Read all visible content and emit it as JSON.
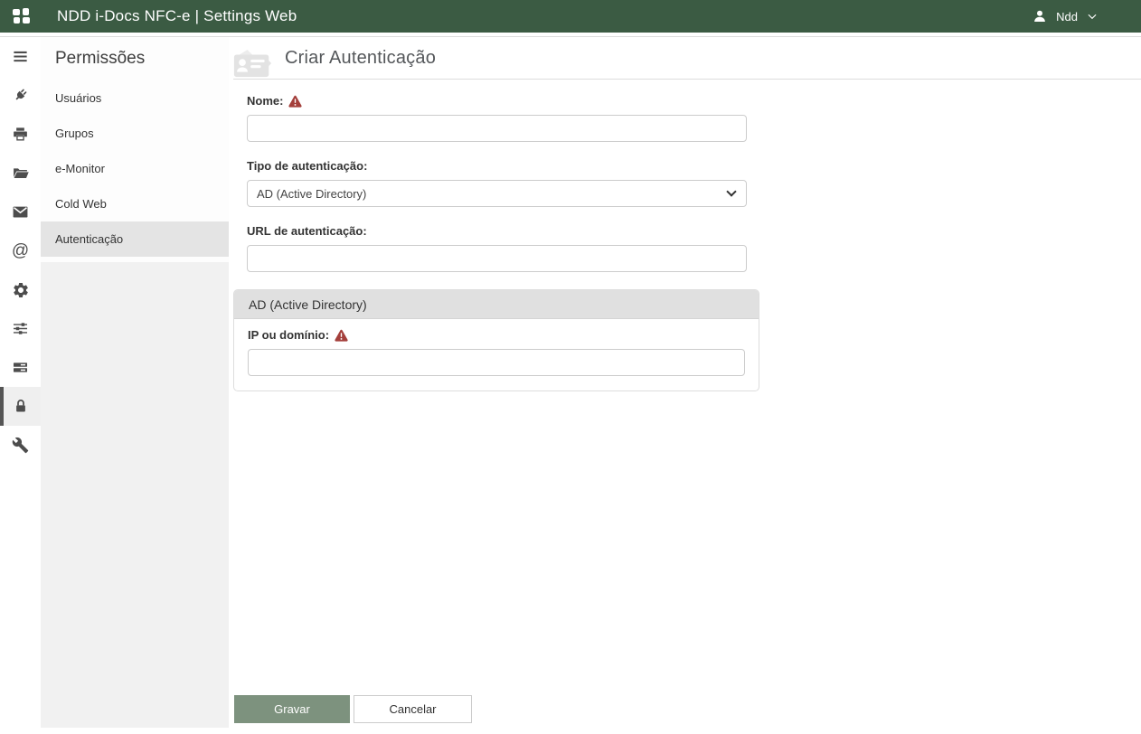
{
  "topbar": {
    "title": "NDD i-Docs NFC-e | Settings Web",
    "user": "Ndd"
  },
  "rail": {
    "items": [
      {
        "icon": "menu-icon",
        "selected": false
      },
      {
        "icon": "plug-icon",
        "selected": false
      },
      {
        "icon": "printer-icon",
        "selected": false
      },
      {
        "icon": "folder-open-icon",
        "selected": false
      },
      {
        "icon": "envelope-icon",
        "selected": false
      },
      {
        "icon": "at-icon",
        "selected": false
      },
      {
        "icon": "gear-icon",
        "selected": false
      },
      {
        "icon": "sliders-icon",
        "selected": false
      },
      {
        "icon": "stack-icon",
        "selected": false
      },
      {
        "icon": "lock-icon",
        "selected": true
      },
      {
        "icon": "wrench-icon",
        "selected": false
      }
    ],
    "at_glyph": "@"
  },
  "sidebar": {
    "title": "Permissões",
    "items": [
      {
        "label": "Usuários",
        "selected": false
      },
      {
        "label": "Grupos",
        "selected": false
      },
      {
        "label": "e-Monitor",
        "selected": false
      },
      {
        "label": "Cold Web",
        "selected": false
      },
      {
        "label": "Autenticação",
        "selected": true
      }
    ]
  },
  "main": {
    "title": "Criar Autenticação",
    "fields": {
      "nome": {
        "label": "Nome:",
        "value": "",
        "required": true
      },
      "tipo": {
        "label": "Tipo de autenticação:",
        "value": "AD (Active Directory)"
      },
      "url": {
        "label": "URL de autenticação:",
        "value": ""
      }
    },
    "panel": {
      "title": "AD (Active Directory)",
      "fields": {
        "ip": {
          "label": "IP ou domínio:",
          "value": "",
          "required": true
        }
      }
    },
    "buttons": {
      "save": "Gravar",
      "cancel": "Cancelar"
    }
  },
  "colors": {
    "topbar_bg": "#3B5B43",
    "save_button_bg": "#7D927E",
    "warning_red": "#A43F3B",
    "selected_item_bg": "#E4E4E4",
    "panel_header_bg": "#E0E0E0"
  }
}
